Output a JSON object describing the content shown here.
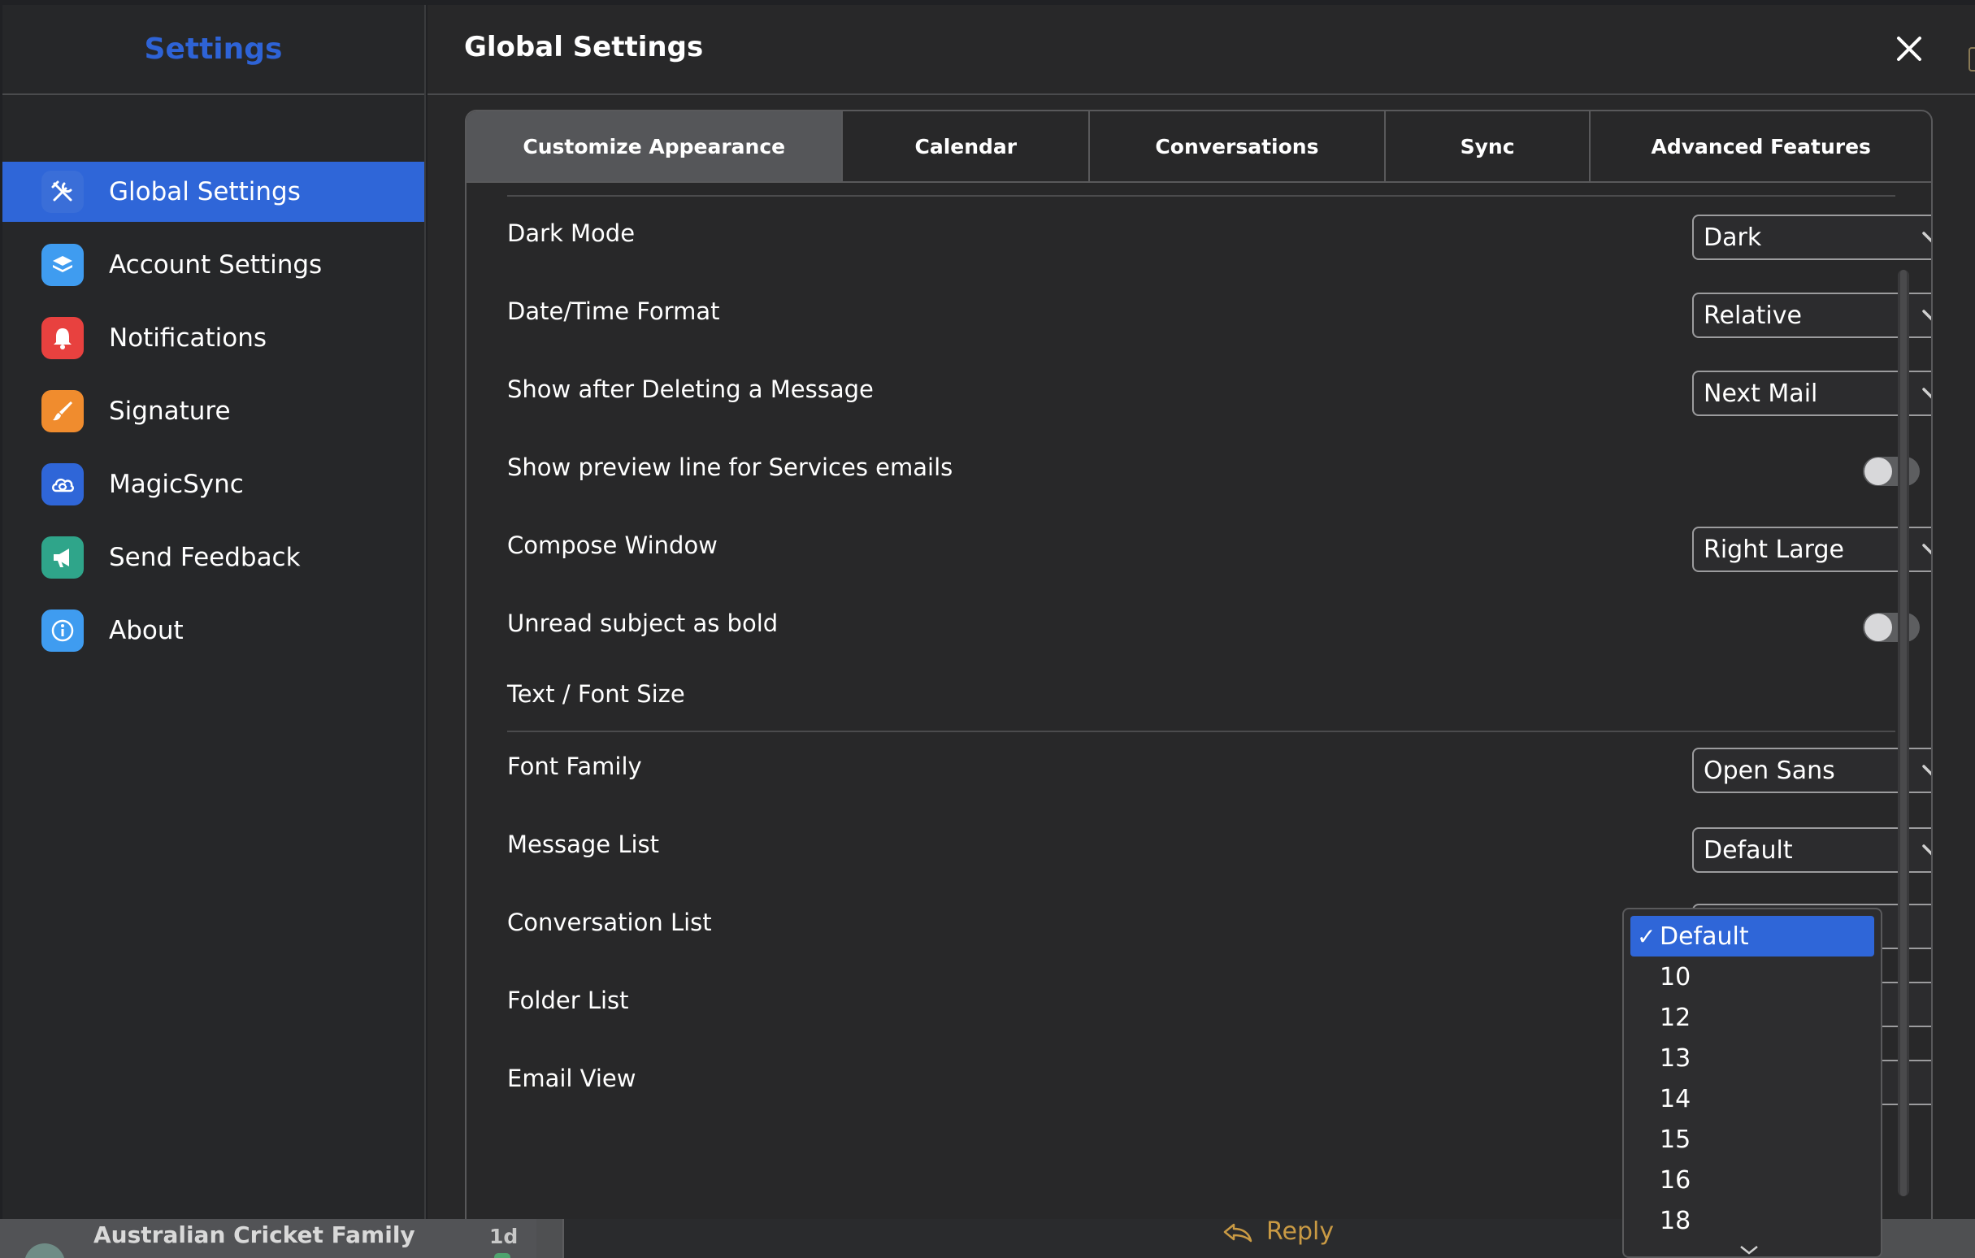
{
  "sidebar": {
    "title": "Settings",
    "items": [
      {
        "label": "Global Settings",
        "icon": "tools-icon",
        "color": "#2f66d8",
        "active": true
      },
      {
        "label": "Account Settings",
        "icon": "layers-icon",
        "color": "#3f9cf0",
        "active": false
      },
      {
        "label": "Notifications",
        "icon": "bell-icon",
        "color": "#e8413f",
        "active": false
      },
      {
        "label": "Signature",
        "icon": "brush-icon",
        "color": "#f08c2e",
        "active": false
      },
      {
        "label": "MagicSync",
        "icon": "cloud-sync-icon",
        "color": "#2f66d8",
        "active": false
      },
      {
        "label": "Send Feedback",
        "icon": "megaphone-icon",
        "color": "#2fa58a",
        "active": false
      },
      {
        "label": "About",
        "icon": "info-icon",
        "color": "#3f9cf0",
        "active": false
      }
    ]
  },
  "main": {
    "title": "Global Settings",
    "close_icon": "close-icon",
    "tabs": [
      {
        "label": "Customize Appearance",
        "active": true
      },
      {
        "label": "Calendar",
        "active": false
      },
      {
        "label": "Conversations",
        "active": false
      },
      {
        "label": "Sync",
        "active": false
      },
      {
        "label": "Advanced Features",
        "active": false
      }
    ],
    "settings": {
      "dark_mode": {
        "label": "Dark Mode",
        "value": "Dark"
      },
      "datetime_format": {
        "label": "Date/Time Format",
        "value": "Relative"
      },
      "after_delete": {
        "label": "Show after Deleting a Message",
        "value": "Next Mail"
      },
      "preview_line": {
        "label": "Show preview line for Services emails",
        "on": false
      },
      "compose_window": {
        "label": "Compose Window",
        "value": "Right Large"
      },
      "unread_bold": {
        "label": "Unread subject as bold",
        "on": false
      },
      "font_section": {
        "label": "Text / Font Size"
      },
      "font_family": {
        "label": "Font Family",
        "value": "Open Sans"
      },
      "message_list": {
        "label": "Message List",
        "value": "Default"
      },
      "conversation_list": {
        "label": "Conversation List"
      },
      "folder_list": {
        "label": "Folder List"
      },
      "email_view": {
        "label": "Email View"
      }
    }
  },
  "dropdown": {
    "selected": "Default",
    "check": "✓",
    "options": [
      "10",
      "12",
      "13",
      "14",
      "15",
      "16",
      "18"
    ]
  },
  "background": {
    "conversation_name": "Australian Cricket Family",
    "time": "1d",
    "reply_label": "Reply"
  },
  "colors": {
    "accent": "#2f66d8",
    "sidebar_title": "#2e63d6",
    "reply": "#c99a44"
  }
}
